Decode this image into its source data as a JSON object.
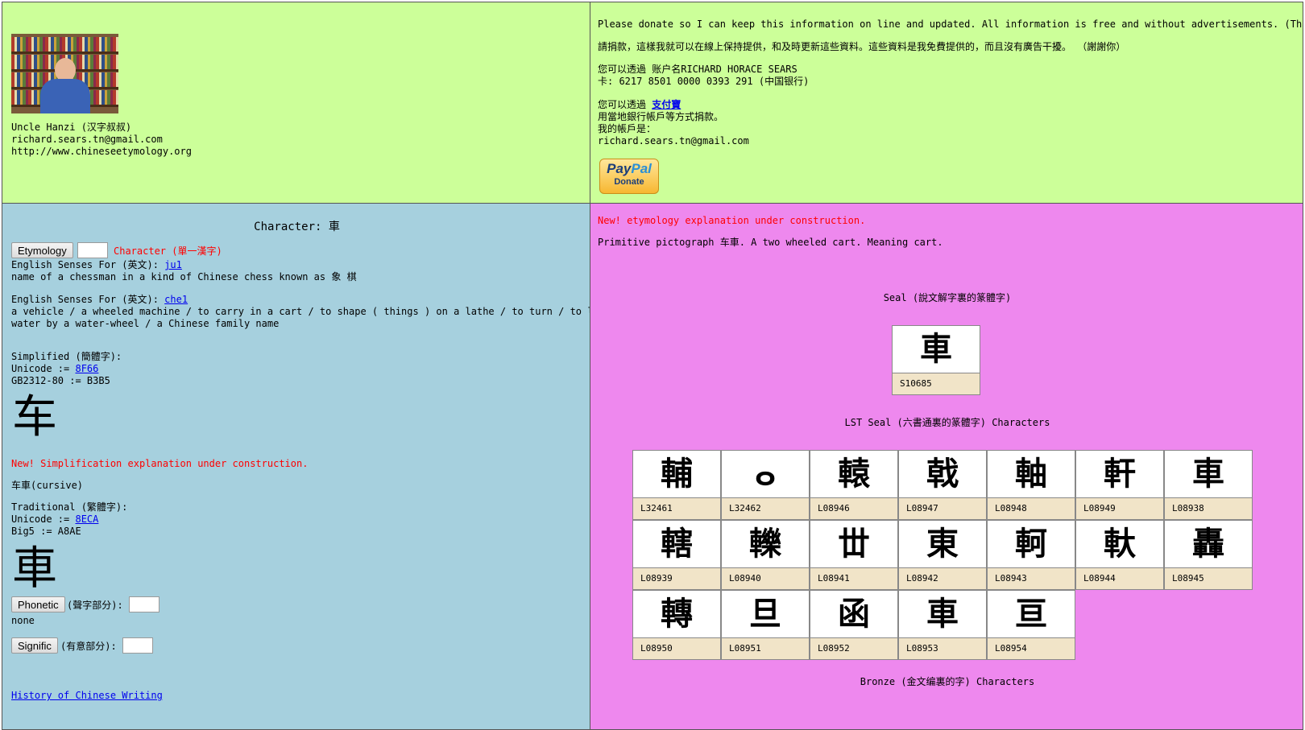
{
  "profile": {
    "name": "Uncle Hanzi (汉字叔叔)",
    "email": "richard.sears.tn@gmail.com",
    "website": "http://www.chineseetymology.org"
  },
  "donate": {
    "line_en": "Please donate so I can keep this information on line and updated. All information is free and without advertisements. (Thank you)",
    "line_zh": "請捐款，這樣我就可以在線上保持提供，和及時更新這些資料。這些資料是我免費提供的，而且沒有廣告干擾。 （謝謝你）",
    "bank_line1": "您可以透過 账户名RICHARD HORACE SEARS",
    "bank_line2": "卡: 6217 8501 0000 0393 291 (中国银行)",
    "alipay_prefix": "您可以透過 ",
    "alipay_link": "支付寶",
    "alipay_line2": "用當地銀行帳戶等方式捐款。",
    "account_label": "我的帳戶是：",
    "account_email": "richard.sears.tn@gmail.com",
    "paypal_brand_1": "Pay",
    "paypal_brand_2": "Pal",
    "paypal_donate": "Donate"
  },
  "char_panel": {
    "title": "Character: 車",
    "etymology_button": "Etymology",
    "etymology_input": "",
    "character_label": "Character (單一漢字)",
    "sense1_label": "English Senses For (英文): ",
    "sense1_link": "ju1",
    "sense1_text": "name of a chessman in a kind of Chinese chess known as 象 棋",
    "sense2_label": "English Senses For (英文): ",
    "sense2_link": "che1",
    "sense2_text_1": "a vehicle / a wheeled machine / to carry in a cart / to shape ( things ) on a lathe / to turn / to lift",
    "sense2_text_2": "water by a water-wheel / a Chinese family name",
    "simplified_label": "Simplified (簡體字):",
    "simplified_unicode_label": "Unicode := ",
    "simplified_unicode_link": "8F66",
    "simplified_gb": "GB2312-80 := B3B5",
    "simplified_glyph": "车",
    "simplification_note": "New! Simplification explanation under construction.",
    "cursive": "车車(cursive)",
    "traditional_label": "Traditional (繁體字):",
    "traditional_unicode_label": "Unicode := ",
    "traditional_unicode_link": "8ECA",
    "traditional_big5": "Big5 := A8AE",
    "traditional_glyph": "車",
    "phonetic_button": "Phonetic",
    "phonetic_label": "(聲字部分):",
    "phonetic_value": "none",
    "signific_button": "Signific",
    "signific_label": "(有意部分):",
    "history_link": "History of Chinese Writing "
  },
  "etymology_panel": {
    "note": "New! etymology explanation under construction.",
    "description": "Primitive pictograph 车車. A two wheeled cart. Meaning cart.",
    "seal_title": "Seal (說文解字裏的篆體字)",
    "seal_tiles": [
      {
        "glyph": "車",
        "label": "S10685"
      }
    ],
    "lst_title": "LST Seal (六書通裏的篆體字) Characters",
    "lst_tiles": [
      {
        "glyph": "輔",
        "label": "L32461"
      },
      {
        "glyph": "ⴰ",
        "label": "L32462"
      },
      {
        "glyph": "轅",
        "label": "L08946"
      },
      {
        "glyph": "戟",
        "label": "L08947"
      },
      {
        "glyph": "軸",
        "label": "L08948"
      },
      {
        "glyph": "軒",
        "label": "L08949"
      },
      {
        "glyph": "車",
        "label": "L08938"
      },
      {
        "glyph": "轄",
        "label": "L08939"
      },
      {
        "glyph": "轢",
        "label": "L08940"
      },
      {
        "glyph": "丗",
        "label": "L08941"
      },
      {
        "glyph": "東",
        "label": "L08942"
      },
      {
        "glyph": "軻",
        "label": "L08943"
      },
      {
        "glyph": "軑",
        "label": "L08944"
      },
      {
        "glyph": "轟",
        "label": "L08945"
      },
      {
        "glyph": "轉",
        "label": "L08950"
      },
      {
        "glyph": "旦",
        "label": "L08951"
      },
      {
        "glyph": "函",
        "label": "L08952"
      },
      {
        "glyph": "車",
        "label": "L08953"
      },
      {
        "glyph": "亘",
        "label": "L08954"
      }
    ],
    "bronze_title": "Bronze (金文编裏的字) Characters"
  }
}
